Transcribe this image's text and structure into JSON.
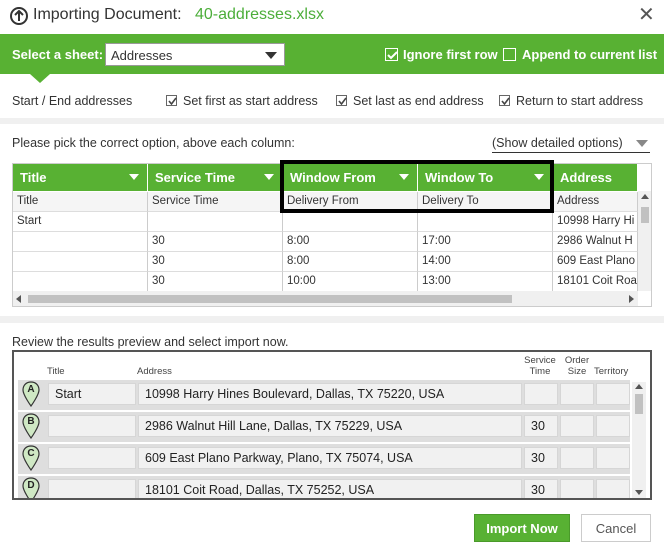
{
  "title": {
    "prefix": "Importing Document:",
    "filename": "40-addresses.xlsx"
  },
  "sheet": {
    "label": "Select a sheet:",
    "value": "Addresses"
  },
  "options": {
    "ignore_first_row": "Ignore first row",
    "append_to_list": "Append to current list"
  },
  "start_end": {
    "label": "Start / End addresses",
    "set_first": "Set first as start address",
    "set_last": "Set last as end address",
    "return_start": "Return to start address"
  },
  "pick_label": "Please pick the correct option, above each column:",
  "detail_options": "(Show detailed options)",
  "mapping": {
    "headers": [
      "Title",
      "Service Time",
      "Window From",
      "Window To",
      "Address"
    ],
    "file_headers": [
      "Title",
      "Service Time",
      "Delivery From",
      "Delivery To",
      "Address"
    ],
    "rows": [
      [
        "Start",
        "",
        "",
        "",
        "10998 Harry Hi"
      ],
      [
        "",
        "30",
        "8:00",
        "17:00",
        "2986 Walnut H"
      ],
      [
        "",
        "30",
        "8:00",
        "14:00",
        "609 East Plano"
      ],
      [
        "",
        "30",
        "10:00",
        "13:00",
        "18101 Coit Roa"
      ]
    ]
  },
  "review_label": "Review the results preview and select import now.",
  "preview": {
    "headers": {
      "title": "Title",
      "address": "Address",
      "service_time": "Service Time",
      "order_size": "Order Size",
      "territory": "Territory"
    },
    "rows": [
      {
        "marker": "A",
        "title": "Start",
        "address": "10998 Harry Hines Boulevard, Dallas, TX 75220, USA",
        "service_time": ""
      },
      {
        "marker": "B",
        "title": "",
        "address": "2986 Walnut Hill Lane, Dallas, TX 75229, USA",
        "service_time": "30"
      },
      {
        "marker": "C",
        "title": "",
        "address": "609 East Plano Parkway, Plano, TX 75074, USA",
        "service_time": "30"
      },
      {
        "marker": "D",
        "title": "",
        "address": "18101 Coit Road, Dallas, TX 75252, USA",
        "service_time": "30"
      }
    ]
  },
  "buttons": {
    "import": "Import Now",
    "cancel": "Cancel"
  },
  "colors": {
    "accent": "#58b133",
    "filename": "#4cae3a",
    "highlight": "#000000"
  }
}
